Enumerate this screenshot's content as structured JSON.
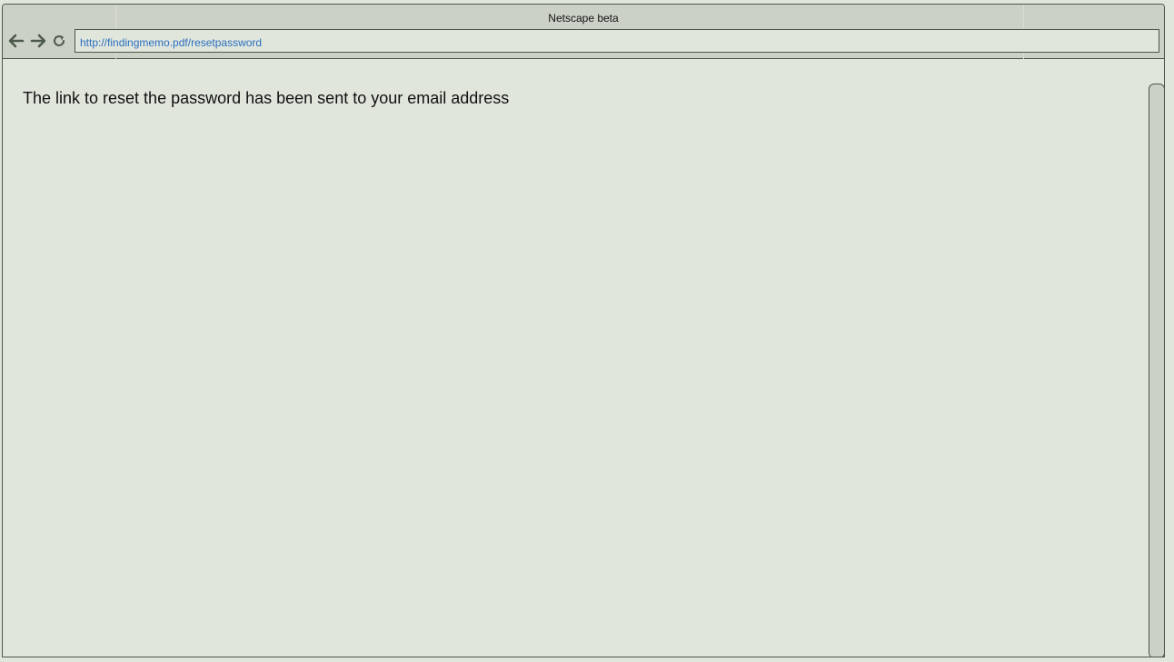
{
  "window": {
    "title": "Netscape beta"
  },
  "toolbar": {
    "back_icon": "arrow-left-icon",
    "forward_icon": "arrow-right-icon",
    "reload_icon": "reload-icon",
    "address": "http://findingmemo.pdf/resetpassword"
  },
  "page": {
    "message": "The link to reset the password has been sent to your email address"
  },
  "colors": {
    "chrome_background": "#ccd1c8",
    "page_background": "#e1e6dd",
    "border": "#4a5648",
    "url_text": "#2a6fbf",
    "icon": "#4d5a4b"
  }
}
